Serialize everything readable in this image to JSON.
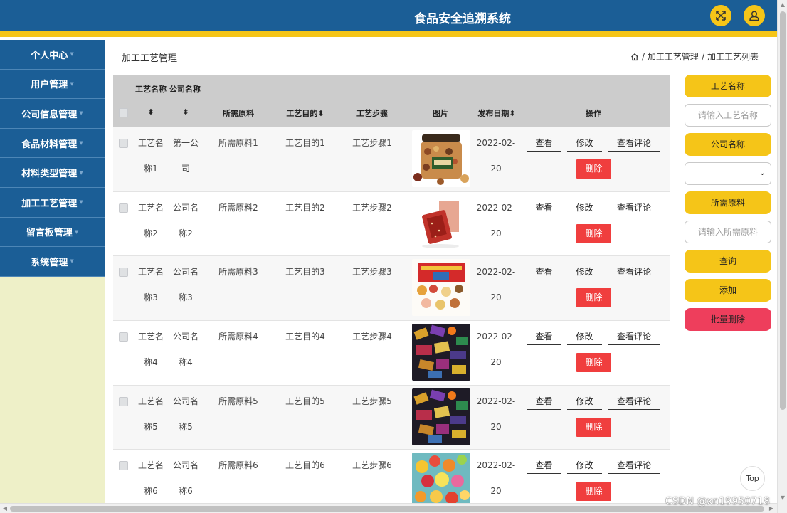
{
  "header": {
    "title": "食品安全追溯系统",
    "accent": "#f5c518",
    "brand": "#1b5e96"
  },
  "sidebar": {
    "items": [
      {
        "label": "个人中心"
      },
      {
        "label": "用户管理"
      },
      {
        "label": "公司信息管理"
      },
      {
        "label": "食品材料管理"
      },
      {
        "label": "材料类型管理"
      },
      {
        "label": "加工工艺管理"
      },
      {
        "label": "留言板管理"
      },
      {
        "label": "系统管理"
      }
    ]
  },
  "page": {
    "title": "加工工艺管理"
  },
  "breadcrumb": {
    "home_icon": "home-icon",
    "sep": "/",
    "items": [
      "加工工艺管理",
      "加工工艺列表"
    ]
  },
  "table": {
    "top_headers": "工艺名称 公司名称",
    "columns": [
      "所需原料",
      "工艺目的",
      "工艺步骤",
      "图片",
      "发布日期",
      "操作"
    ],
    "sort_marks": [
      "⬍",
      "⬍",
      "⬍",
      "⬍"
    ],
    "rows": [
      {
        "name1": "工艺名",
        "name2": "称1",
        "company1": "第一公",
        "company2": "司",
        "material": "所需原料1",
        "purpose": "工艺目的1",
        "steps": "工艺步骤1",
        "date1": "2022-02-",
        "date2": "20",
        "image": "mixed-nuts-jar"
      },
      {
        "name1": "工艺名",
        "name2": "称2",
        "company1": "公司名",
        "company2": "称2",
        "material": "所需原料2",
        "purpose": "工艺目的2",
        "steps": "工艺步骤2",
        "date1": "2022-02-",
        "date2": "20",
        "image": "jerky-snack-pack"
      },
      {
        "name1": "工艺名",
        "name2": "称3",
        "company1": "公司名",
        "company2": "称3",
        "material": "所需原料3",
        "purpose": "工艺目的3",
        "steps": "工艺步骤3",
        "date1": "2022-02-",
        "date2": "20",
        "image": "snack-gift-box"
      },
      {
        "name1": "工艺名",
        "name2": "称4",
        "company1": "公司名",
        "company2": "称4",
        "material": "所需原料4",
        "purpose": "工艺目的4",
        "steps": "工艺步骤4",
        "date1": "2022-02-",
        "date2": "20",
        "image": "assorted-candy"
      },
      {
        "name1": "工艺名",
        "name2": "称5",
        "company1": "公司名",
        "company2": "称5",
        "material": "所需原料5",
        "purpose": "工艺目的5",
        "steps": "工艺步骤5",
        "date1": "2022-02-",
        "date2": "20",
        "image": "assorted-candy"
      },
      {
        "name1": "工艺名",
        "name2": "称6",
        "company1": "公司名",
        "company2": "称6",
        "material": "所需原料6",
        "purpose": "工艺目的6",
        "steps": "工艺步骤6",
        "date1": "2022-02-",
        "date2": "20",
        "image": "gummy-candies"
      }
    ],
    "actions": {
      "view": "查看",
      "edit": "修改",
      "comments": "查看评论",
      "delete": "删除"
    }
  },
  "search": {
    "name_label": "工艺名称",
    "name_placeholder": "请输入工艺名称",
    "company_label": "公司名称",
    "material_label": "所需原料",
    "material_placeholder": "请输入所需原料",
    "query": "查询",
    "add": "添加",
    "batch_delete": "批量删除"
  },
  "back_to_top": "Top",
  "watermark": "CSDN @xn19950718"
}
